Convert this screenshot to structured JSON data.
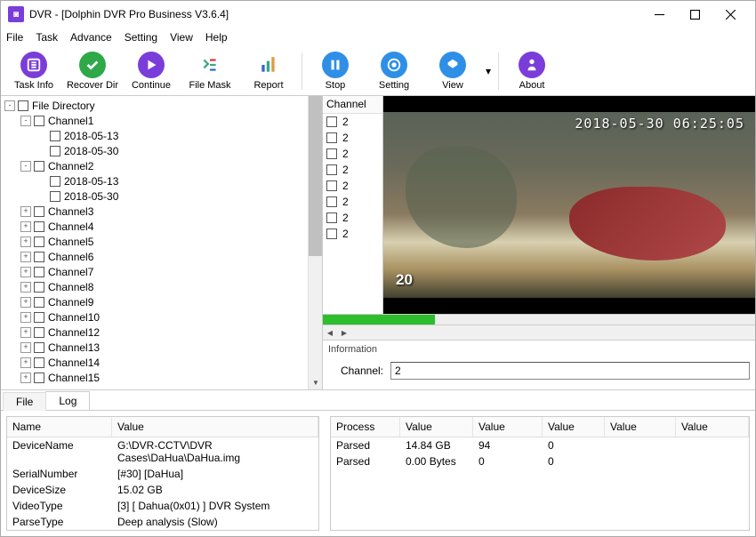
{
  "window": {
    "title": "DVR - [Dolphin DVR Pro Business V3.6.4]"
  },
  "menubar": [
    "File",
    "Task",
    "Advance",
    "Setting",
    "View",
    "Help"
  ],
  "toolbar": [
    {
      "id": "task-info",
      "label": "Task Info",
      "color": "#7a3dd9"
    },
    {
      "id": "recover-dir",
      "label": "Recover Dir",
      "color": "#2fa84a"
    },
    {
      "id": "continue",
      "label": "Continue",
      "color": "#7a3dd9"
    },
    {
      "id": "file-mask",
      "label": "File Mask",
      "color": ""
    },
    {
      "id": "report",
      "label": "Report",
      "color": ""
    },
    {
      "id": "stop",
      "label": "Stop",
      "color": "#2f8fe6"
    },
    {
      "id": "setting",
      "label": "Setting",
      "color": "#2f8fe6"
    },
    {
      "id": "view",
      "label": "View",
      "color": "#2f8fe6"
    },
    {
      "id": "about",
      "label": "About",
      "color": "#7a3dd9"
    }
  ],
  "tree": {
    "root": "File Directory",
    "nodes": [
      {
        "label": "Channel1",
        "exp": "-",
        "indent": 1,
        "children": [
          "2018-05-13",
          "2018-05-30"
        ]
      },
      {
        "label": "Channel2",
        "exp": "-",
        "indent": 1,
        "children": [
          "2018-05-13",
          "2018-05-30"
        ]
      },
      {
        "label": "Channel3",
        "exp": "+",
        "indent": 1
      },
      {
        "label": "Channel4",
        "exp": "+",
        "indent": 1
      },
      {
        "label": "Channel5",
        "exp": "+",
        "indent": 1
      },
      {
        "label": "Channel6",
        "exp": "+",
        "indent": 1
      },
      {
        "label": "Channel7",
        "exp": "+",
        "indent": 1
      },
      {
        "label": "Channel8",
        "exp": "+",
        "indent": 1
      },
      {
        "label": "Channel9",
        "exp": "+",
        "indent": 1
      },
      {
        "label": "Channel10",
        "exp": "+",
        "indent": 1
      },
      {
        "label": "Channel12",
        "exp": "+",
        "indent": 1
      },
      {
        "label": "Channel13",
        "exp": "+",
        "indent": 1
      },
      {
        "label": "Channel14",
        "exp": "+",
        "indent": 1
      },
      {
        "label": "Channel15",
        "exp": "+",
        "indent": 1
      }
    ]
  },
  "channel_panel": {
    "header": "Channel",
    "items": [
      "2",
      "2",
      "2",
      "2",
      "2",
      "2",
      "2",
      "2"
    ]
  },
  "preview": {
    "timestamp": "2018-05-30 06:25:05",
    "corner_num": "20"
  },
  "information": {
    "title": "Information",
    "channel_label": "Channel:",
    "channel_value": "2"
  },
  "bottom_tabs": [
    "File",
    "Log"
  ],
  "active_tab": 1,
  "file_table": {
    "headers": [
      "Name",
      "Value"
    ],
    "rows": [
      [
        "DeviceName",
        "G:\\DVR-CCTV\\DVR Cases\\DaHua\\DaHua.img"
      ],
      [
        "SerialNumber",
        "[#30]  [DaHua]"
      ],
      [
        "DeviceSize",
        "15.02 GB"
      ],
      [
        "VideoType",
        "[3]  [ Dahua(0x01) ] DVR System"
      ],
      [
        "ParseType",
        "Deep analysis (Slow)"
      ]
    ]
  },
  "process_table": {
    "headers": [
      "Process",
      "Value",
      "Value",
      "Value",
      "Value",
      "Value"
    ],
    "rows": [
      [
        "Parsed",
        "14.84 GB",
        "94",
        "0",
        "",
        ""
      ],
      [
        "Parsed",
        "0.00 Bytes",
        "0",
        "0",
        "",
        ""
      ]
    ]
  }
}
